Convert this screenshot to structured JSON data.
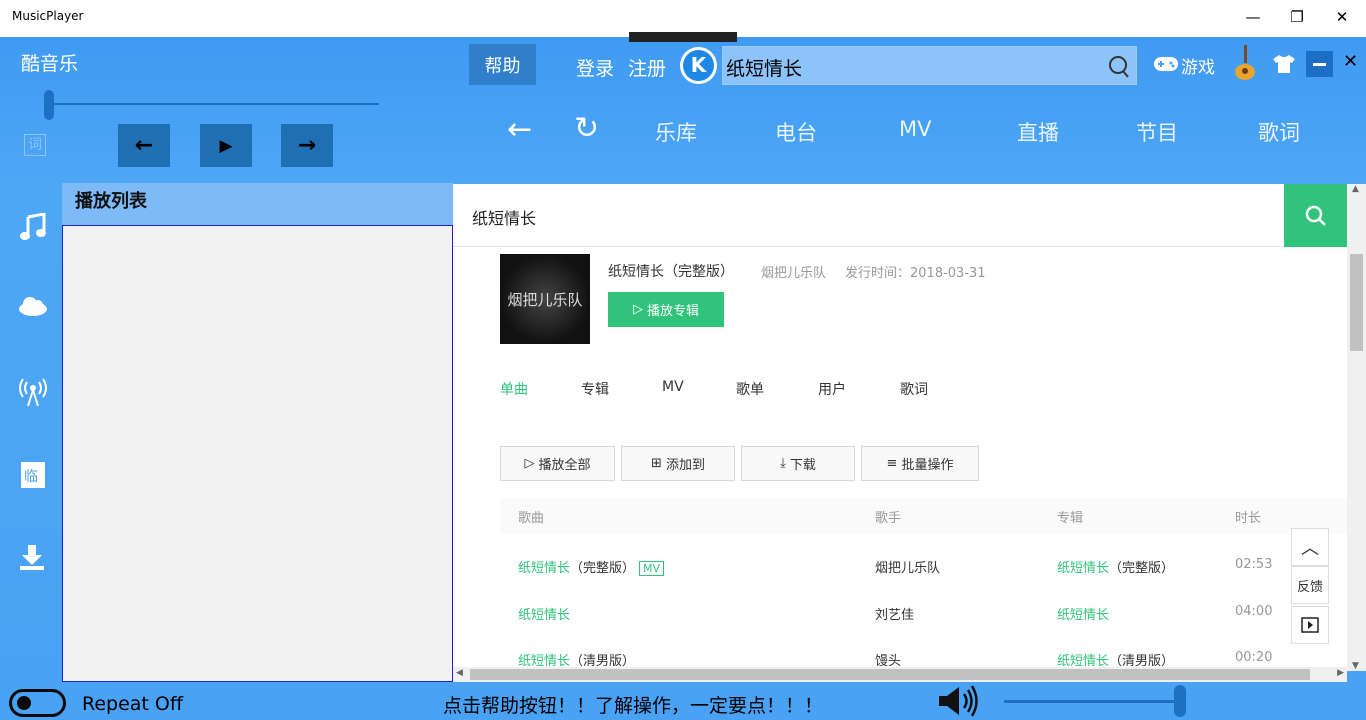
{
  "window": {
    "title": "MusicPlayer",
    "minimize": "—",
    "restore": "❐",
    "close": "✕"
  },
  "header": {
    "logo": "酷音乐",
    "help": "帮助",
    "login": "登录",
    "register": "注册",
    "search_value": "纸短情长",
    "game": "游戏"
  },
  "lyric_label": "词",
  "controls": {
    "prev": "←",
    "play": "▶",
    "next": "→"
  },
  "nav": {
    "back": "←",
    "refresh": "↻",
    "items": [
      "乐库",
      "电台",
      "MV",
      "直播",
      "节目",
      "歌词"
    ]
  },
  "playlist": {
    "title": "播放列表"
  },
  "web": {
    "search_value": "纸短情长",
    "album": {
      "cover_text": "烟把儿乐队",
      "name": "纸短情长（完整版）",
      "artist": "烟把儿乐队",
      "release": "发行时间：2018-03-31",
      "play_button": "播放专辑"
    },
    "tabs": [
      "单曲",
      "专辑",
      "MV",
      "歌单",
      "用户",
      "歌词"
    ],
    "actions": [
      "播放全部",
      "添加到",
      "下载",
      "批量操作"
    ],
    "columns": [
      "歌曲",
      "歌手",
      "专辑",
      "时长"
    ],
    "songs": [
      {
        "title": "纸短情长",
        "suffix": "（完整版）",
        "mv": "MV",
        "artist": "烟把儿乐队",
        "album": "纸短情长",
        "album_suffix": "（完整版）",
        "duration": "02:53"
      },
      {
        "title": "纸短情长",
        "suffix": "",
        "mv": "",
        "artist": "刘艺佳",
        "album": "纸短情长",
        "album_suffix": "",
        "duration": "04:00"
      },
      {
        "title": "纸短情长",
        "suffix": "（清男版）",
        "mv": "",
        "artist": "馒头",
        "album": "纸短情长",
        "album_suffix": "（清男版）",
        "duration": "00:20"
      }
    ],
    "side_tools": {
      "top": "︿",
      "feedback": "反馈"
    }
  },
  "footer": {
    "repeat": "Repeat Off",
    "tip": "点击帮助按钮！！了解操作，一定要点！！！"
  },
  "colors": {
    "accent": "#31c27c",
    "bg": "#4aa2f4"
  }
}
